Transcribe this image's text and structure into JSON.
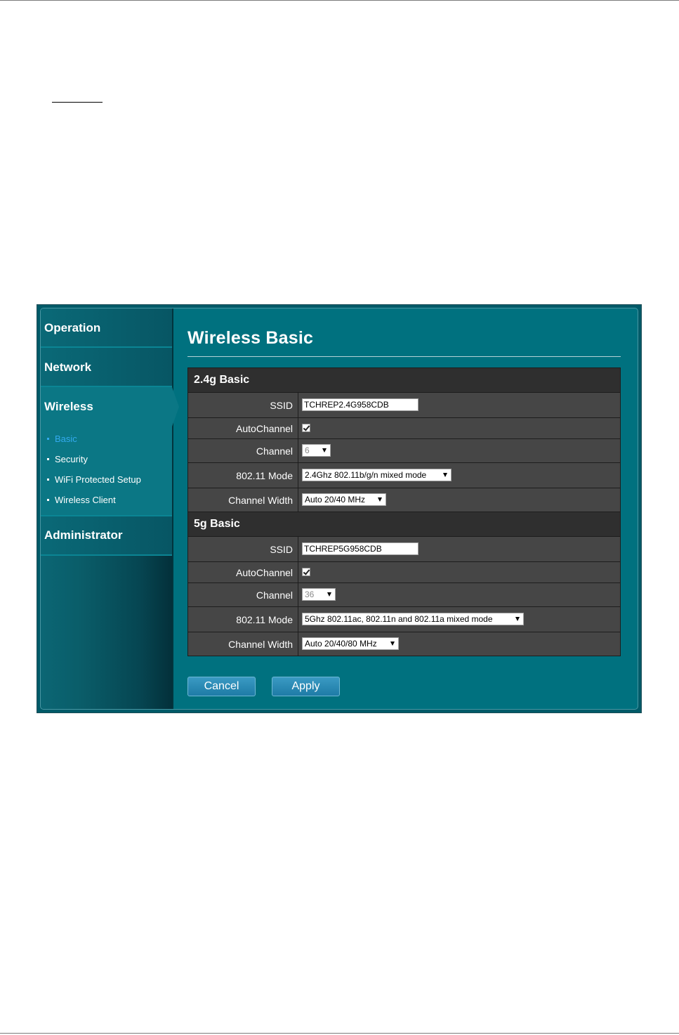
{
  "sidebar": {
    "groups": [
      {
        "label": "Operation"
      },
      {
        "label": "Network"
      },
      {
        "label": "Wireless"
      },
      {
        "label": "Administrator"
      }
    ],
    "wireless_items": [
      {
        "label": "Basic"
      },
      {
        "label": "Security"
      },
      {
        "label": "WiFi Protected Setup"
      },
      {
        "label": "Wireless Client"
      }
    ]
  },
  "main": {
    "title": "Wireless Basic",
    "sections": [
      {
        "title": "2.4g Basic",
        "ssid_label": "SSID",
        "ssid_value": "TCHREP2.4G958CDB",
        "autochannel_label": "AutoChannel",
        "autochannel_checked": true,
        "channel_label": "Channel",
        "channel_value": "6",
        "mode_label": "802.11 Mode",
        "mode_value": "2.4Ghz 802.11b/g/n mixed mode",
        "width_label": "Channel Width",
        "width_value": "Auto 20/40 MHz"
      },
      {
        "title": "5g Basic",
        "ssid_label": "SSID",
        "ssid_value": "TCHREP5G958CDB",
        "autochannel_label": "AutoChannel",
        "autochannel_checked": true,
        "channel_label": "Channel",
        "channel_value": "36",
        "mode_label": "802.11 Mode",
        "mode_value": "5Ghz 802.11ac, 802.11n and 802.11a mixed mode",
        "width_label": "Channel Width",
        "width_value": "Auto 20/40/80 MHz"
      }
    ],
    "buttons": {
      "cancel": "Cancel",
      "apply": "Apply"
    }
  },
  "colors": {
    "frame_bg": "#00717f",
    "sidebar_active": "#0b7785",
    "active_link": "#33aaee",
    "table_row": "#464646",
    "section_header": "#2f2f2f",
    "button": "#1e7ba6"
  }
}
